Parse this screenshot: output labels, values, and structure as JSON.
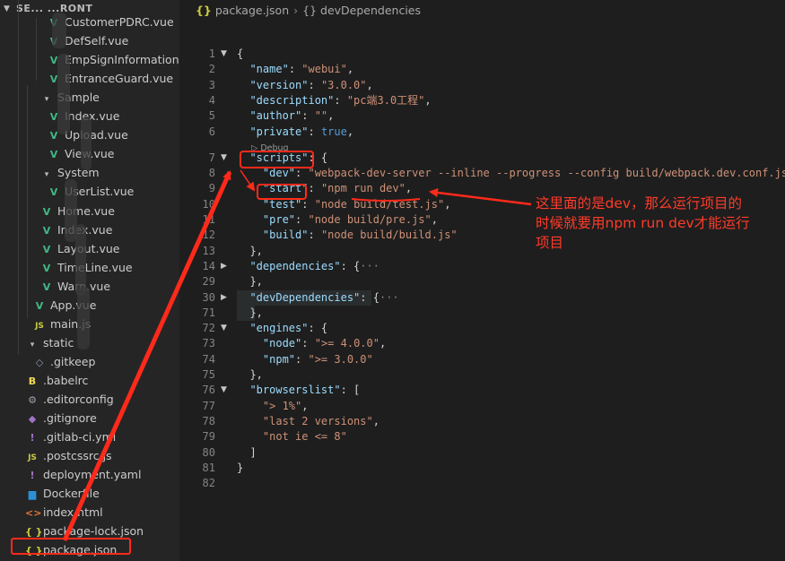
{
  "sidebar": {
    "header": "SE...  ...RONT",
    "items": [
      {
        "icon": "vue",
        "label": "CustomerPDRC.vue",
        "depth": 3
      },
      {
        "icon": "vue",
        "label": "DefSelf.vue",
        "depth": 3
      },
      {
        "icon": "vue",
        "label": "EmpSignInformation.vue",
        "depth": 3
      },
      {
        "icon": "vue",
        "label": "EntranceGuard.vue",
        "depth": 3
      },
      {
        "icon": "folder-open",
        "label": "Sample",
        "depth": 2
      },
      {
        "icon": "vue",
        "label": "Index.vue",
        "depth": 3
      },
      {
        "icon": "vue",
        "label": "Upload.vue",
        "depth": 3
      },
      {
        "icon": "vue",
        "label": "View.vue",
        "depth": 3
      },
      {
        "icon": "folder-open",
        "label": "System",
        "depth": 2
      },
      {
        "icon": "vue",
        "label": "UserList.vue",
        "depth": 3
      },
      {
        "icon": "vue",
        "label": "Home.vue",
        "depth": 2
      },
      {
        "icon": "vue",
        "label": "Index.vue",
        "depth": 2
      },
      {
        "icon": "vue",
        "label": "Layout.vue",
        "depth": 2
      },
      {
        "icon": "vue",
        "label": "TimeLine.vue",
        "depth": 2
      },
      {
        "icon": "vue",
        "label": "Warn.vue",
        "depth": 2
      },
      {
        "icon": "vue",
        "label": "App.vue",
        "depth": 1
      },
      {
        "icon": "js",
        "label": "main.js",
        "depth": 1
      },
      {
        "icon": "folder-open",
        "label": "static",
        "depth": 0
      },
      {
        "icon": "file",
        "label": ".gitkeep",
        "depth": 1
      },
      {
        "icon": "babel",
        "label": ".babelrc",
        "depth": 0
      },
      {
        "icon": "gear",
        "label": ".editorconfig",
        "depth": 0
      },
      {
        "icon": "git",
        "label": ".gitignore",
        "depth": 0
      },
      {
        "icon": "yaml",
        "label": ".gitlab-ci.yml",
        "depth": 0
      },
      {
        "icon": "js",
        "label": ".postcssrc.js",
        "depth": 0
      },
      {
        "icon": "yaml",
        "label": "deployment.yaml",
        "depth": 0
      },
      {
        "icon": "docker",
        "label": "Dockerfile",
        "depth": 0
      },
      {
        "icon": "html",
        "label": "index.html",
        "depth": 0
      },
      {
        "icon": "json",
        "label": "package-lock.json",
        "depth": 0
      },
      {
        "icon": "json",
        "label": "package.json",
        "depth": 0
      }
    ]
  },
  "breadcrumb": {
    "file": "package.json",
    "symbol": "devDependencies",
    "file_icon": "{}",
    "symbol_icon": "{}"
  },
  "editor": {
    "codelens": "▷ Debug",
    "lines": [
      {
        "n": "1",
        "fold": "v",
        "segs": [
          [
            "p",
            "{"
          ]
        ]
      },
      {
        "n": "2",
        "segs": [
          [
            "p",
            "  "
          ],
          [
            "k",
            "\"name\""
          ],
          [
            "p",
            ": "
          ],
          [
            "s",
            "\"webui\""
          ],
          [
            "p",
            ","
          ]
        ]
      },
      {
        "n": "3",
        "segs": [
          [
            "p",
            "  "
          ],
          [
            "k",
            "\"version\""
          ],
          [
            "p",
            ": "
          ],
          [
            "s",
            "\"3.0.0\""
          ],
          [
            "p",
            ","
          ]
        ]
      },
      {
        "n": "4",
        "segs": [
          [
            "p",
            "  "
          ],
          [
            "k",
            "\"description\""
          ],
          [
            "p",
            ": "
          ],
          [
            "s",
            "\"pc端3.0工程\""
          ],
          [
            "p",
            ","
          ]
        ]
      },
      {
        "n": "5",
        "segs": [
          [
            "p",
            "  "
          ],
          [
            "k",
            "\"author\""
          ],
          [
            "p",
            ": "
          ],
          [
            "s",
            "\"\""
          ],
          [
            "p",
            ","
          ]
        ]
      },
      {
        "n": "6",
        "segs": [
          [
            "p",
            "  "
          ],
          [
            "k",
            "\"private\""
          ],
          [
            "p",
            ": "
          ],
          [
            "b",
            "true"
          ],
          [
            "p",
            ","
          ]
        ]
      },
      {
        "n": "7",
        "fold": "v",
        "segs": [
          [
            "p",
            "  "
          ],
          [
            "k",
            "\"scripts\""
          ],
          [
            "p",
            ": {"
          ]
        ]
      },
      {
        "n": "8",
        "segs": [
          [
            "p",
            "    "
          ],
          [
            "k",
            "\"dev\""
          ],
          [
            "p",
            ": "
          ],
          [
            "s",
            "\"webpack-dev-server --inline --progress --config build/webpack.dev.conf.js\""
          ],
          [
            "p",
            ","
          ]
        ]
      },
      {
        "n": "9",
        "segs": [
          [
            "p",
            "    "
          ],
          [
            "k",
            "\"start\""
          ],
          [
            "p",
            ": "
          ],
          [
            "s",
            "\"npm run dev\""
          ],
          [
            "p",
            ","
          ]
        ]
      },
      {
        "n": "10",
        "segs": [
          [
            "p",
            "    "
          ],
          [
            "k",
            "\"test\""
          ],
          [
            "p",
            ": "
          ],
          [
            "s",
            "\"node build/test.js\""
          ],
          [
            "p",
            ","
          ]
        ]
      },
      {
        "n": "11",
        "segs": [
          [
            "p",
            "    "
          ],
          [
            "k",
            "\"pre\""
          ],
          [
            "p",
            ": "
          ],
          [
            "s",
            "\"node build/pre.js\""
          ],
          [
            "p",
            ","
          ]
        ]
      },
      {
        "n": "12",
        "segs": [
          [
            "p",
            "    "
          ],
          [
            "k",
            "\"build\""
          ],
          [
            "p",
            ": "
          ],
          [
            "s",
            "\"node build/build.js\""
          ]
        ]
      },
      {
        "n": "13",
        "segs": [
          [
            "p",
            "  },"
          ]
        ]
      },
      {
        "n": "14",
        "fold": ">",
        "segs": [
          [
            "p",
            "  "
          ],
          [
            "k",
            "\"dependencies\""
          ],
          [
            "p",
            ": {"
          ],
          [
            "e",
            "···"
          ]
        ]
      },
      {
        "n": "29",
        "segs": [
          [
            "p",
            "  },"
          ]
        ]
      },
      {
        "n": "30",
        "fold": ">",
        "segs": [
          [
            "p",
            "  "
          ],
          [
            "k",
            "\"devDependencies\""
          ],
          [
            "p",
            ": {"
          ],
          [
            "e",
            "···"
          ]
        ]
      },
      {
        "n": "71",
        "segs": [
          [
            "p",
            "  },"
          ]
        ]
      },
      {
        "n": "72",
        "fold": "v",
        "segs": [
          [
            "p",
            "  "
          ],
          [
            "k",
            "\"engines\""
          ],
          [
            "p",
            ": {"
          ]
        ]
      },
      {
        "n": "73",
        "segs": [
          [
            "p",
            "    "
          ],
          [
            "k",
            "\"node\""
          ],
          [
            "p",
            ": "
          ],
          [
            "s",
            "\">= 4.0.0\""
          ],
          [
            "p",
            ","
          ]
        ]
      },
      {
        "n": "74",
        "segs": [
          [
            "p",
            "    "
          ],
          [
            "k",
            "\"npm\""
          ],
          [
            "p",
            ": "
          ],
          [
            "s",
            "\">= 3.0.0\""
          ]
        ]
      },
      {
        "n": "75",
        "segs": [
          [
            "p",
            "  },"
          ]
        ]
      },
      {
        "n": "76",
        "fold": "v",
        "segs": [
          [
            "p",
            "  "
          ],
          [
            "k",
            "\"browserslist\""
          ],
          [
            "p",
            ": ["
          ]
        ]
      },
      {
        "n": "77",
        "segs": [
          [
            "p",
            "    "
          ],
          [
            "s",
            "\"> 1%\""
          ],
          [
            "p",
            ","
          ]
        ]
      },
      {
        "n": "78",
        "segs": [
          [
            "p",
            "    "
          ],
          [
            "s",
            "\"last 2 versions\""
          ],
          [
            "p",
            ","
          ]
        ]
      },
      {
        "n": "79",
        "segs": [
          [
            "p",
            "    "
          ],
          [
            "s",
            "\"not ie <= 8\""
          ]
        ]
      },
      {
        "n": "80",
        "segs": [
          [
            "p",
            "  ]"
          ]
        ]
      },
      {
        "n": "81",
        "segs": [
          [
            "p",
            "}"
          ]
        ]
      },
      {
        "n": "82",
        "segs": []
      }
    ]
  },
  "annotation": {
    "lines": [
      "这里面的是dev，那么运行项目的",
      "时候就要用npm run dev才能运行",
      "项目"
    ],
    "color": "#ff3b2a"
  },
  "colors": {
    "background": "#1e1e1e",
    "sidebar": "#252526",
    "key": "#9cdcfe",
    "string": "#ce9178",
    "boolean": "#569cd6",
    "highlight": "#ff2a1a"
  }
}
